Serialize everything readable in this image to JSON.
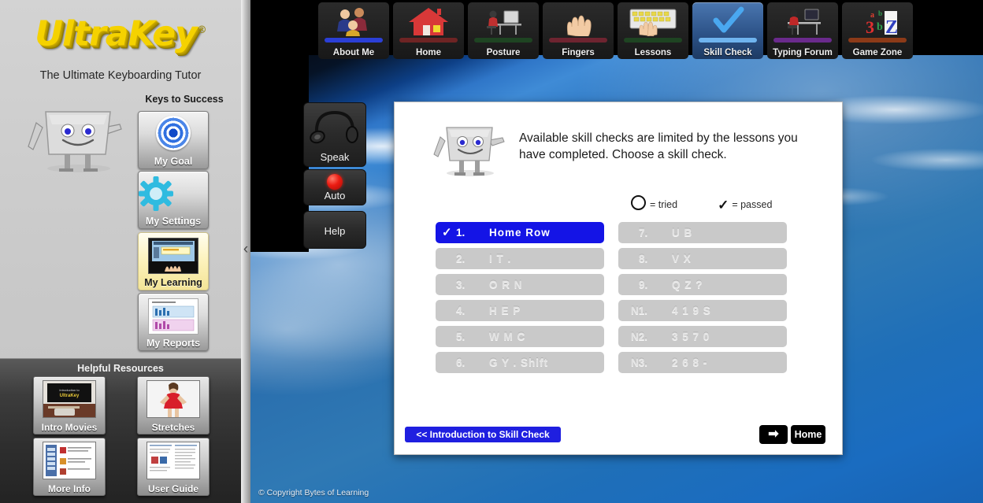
{
  "brand": {
    "logo": "UltraKey",
    "registered": "®",
    "tagline": "The Ultimate Keyboarding Tutor",
    "copyright": "© Copyright Bytes of Learning"
  },
  "sidebar": {
    "keys_to_success_title": "Keys to Success",
    "keys_to_success": [
      {
        "label": "My Goal",
        "icon": "bullseye-icon",
        "active": false
      },
      {
        "label": "My Settings",
        "icon": "gear-icon",
        "active": false
      },
      {
        "label": "My Learning",
        "icon": "learning-thumbnail-icon",
        "active": true
      },
      {
        "label": "My Reports",
        "icon": "reports-chart-icon",
        "active": false
      }
    ],
    "helpful_resources_title": "Helpful Resources",
    "helpful_resources": [
      {
        "label": "Intro Movies",
        "icon": "movie-thumbnail-icon"
      },
      {
        "label": "Stretches",
        "icon": "stretches-thumbnail-icon"
      },
      {
        "label": "More Info",
        "icon": "more-info-thumbnail-icon"
      },
      {
        "label": "User Guide",
        "icon": "user-guide-thumbnail-icon"
      }
    ],
    "collapse_icon": "‹"
  },
  "topnav": {
    "tabs": [
      {
        "label": "About Me",
        "icon": "people-icon",
        "bar": "#2b3fd6",
        "active": false
      },
      {
        "label": "Home",
        "icon": "house-icon",
        "bar": "#6e2424",
        "active": false
      },
      {
        "label": "Posture",
        "icon": "posture-icon",
        "bar": "#1e4422",
        "active": false
      },
      {
        "label": "Fingers",
        "icon": "hand-icon",
        "bar": "#6e2430",
        "active": false
      },
      {
        "label": "Lessons",
        "icon": "keyboard-icon",
        "bar": "#1e4422",
        "active": false
      },
      {
        "label": "Skill Check",
        "icon": "checkmark-icon",
        "bar": "#6fb4ef",
        "active": true
      },
      {
        "label": "Typing Forum",
        "icon": "desk-icon",
        "bar": "#6a2a8c",
        "active": false
      },
      {
        "label": "Game Zone",
        "icon": "letters-icon",
        "bar": "#8c3a18",
        "active": false
      }
    ]
  },
  "controls": [
    {
      "label": "Speak",
      "icon": "headphones-icon"
    },
    {
      "label": "Auto",
      "icon": "red-led-icon"
    },
    {
      "label": "Help",
      "icon": "help-icon"
    }
  ],
  "content": {
    "instruction": "Available skill checks are limited by the lessons you have completed. Choose a skill check.",
    "legend": {
      "tried_label": "= tried",
      "passed_label": "= passed"
    },
    "skills_left": [
      {
        "num": "1.",
        "name": "Home Row",
        "state": "selected",
        "mark": "✓"
      },
      {
        "num": "2.",
        "name": "I  T  .",
        "state": "disabled",
        "mark": ""
      },
      {
        "num": "3.",
        "name": "O  R  N",
        "state": "disabled",
        "mark": ""
      },
      {
        "num": "4.",
        "name": "H  E  P",
        "state": "disabled",
        "mark": ""
      },
      {
        "num": "5.",
        "name": "W  M  C",
        "state": "disabled",
        "mark": ""
      },
      {
        "num": "6.",
        "name": "G  Y  .  Shift",
        "state": "disabled",
        "mark": ""
      }
    ],
    "skills_right": [
      {
        "num": "7.",
        "name": "U  B",
        "state": "disabled",
        "mark": ""
      },
      {
        "num": "8.",
        "name": "V  X",
        "state": "disabled",
        "mark": ""
      },
      {
        "num": "9.",
        "name": "Q  Z  ?",
        "state": "disabled",
        "mark": ""
      },
      {
        "num": "N1.",
        "name": "4  1  9  S",
        "state": "disabled",
        "mark": ""
      },
      {
        "num": "N2.",
        "name": "3  5  7  0",
        "state": "disabled",
        "mark": ""
      },
      {
        "num": "N3.",
        "name": "2  6  8  -",
        "state": "disabled",
        "mark": ""
      }
    ],
    "intro_button": "<< Introduction to Skill Check",
    "next_button": "➡",
    "home_button": "Home"
  },
  "colors": {
    "selected_blue": "#1414e6",
    "disabled_gray": "#c9c9c9",
    "logo_yellow": "#f5d200",
    "accent_blue": "#1f1fe0"
  }
}
